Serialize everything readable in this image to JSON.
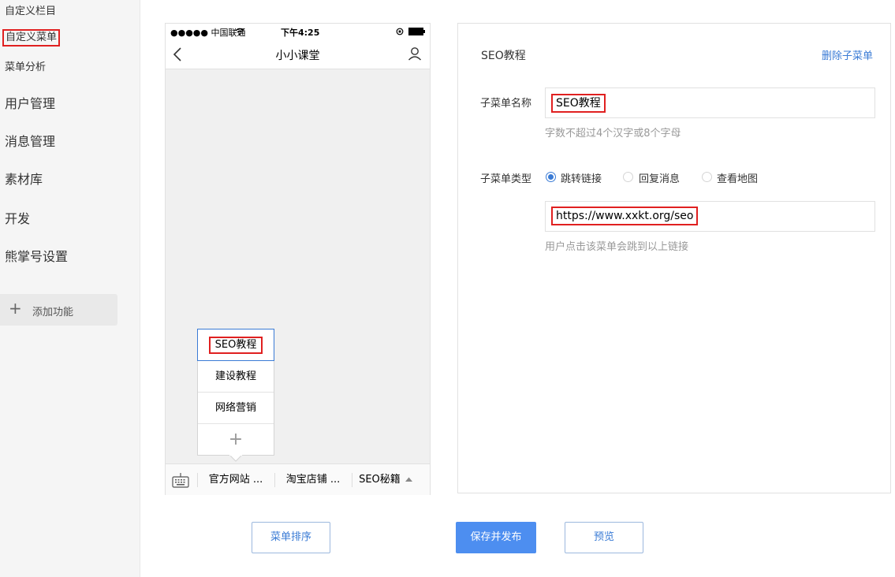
{
  "sidebar": {
    "sub_items": [
      "自定义栏目",
      "自定义菜单",
      "菜单分析"
    ],
    "main_items": [
      "用户管理",
      "消息管理",
      "素材库",
      "开发",
      "熊掌号设置"
    ],
    "add_function": "添加功能"
  },
  "phone": {
    "carrier": "●●●●● 中国联通",
    "time": "下午4:25",
    "title": "小小课堂",
    "menus": [
      "官方网站 ...",
      "淘宝店铺 ...",
      "SEO秘籍"
    ],
    "submenus": [
      "SEO教程",
      "建设教程",
      "网络营销"
    ],
    "add_symbol": "+"
  },
  "editor": {
    "title": "SEO教程",
    "delete_link": "删除子菜单",
    "name_label": "子菜单名称",
    "name_value": "SEO教程",
    "name_hint": "字数不超过4个汉字或8个字母",
    "type_label": "子菜单类型",
    "type_options": [
      "跳转链接",
      "回复消息",
      "查看地图"
    ],
    "url_value": "https://www.xxkt.org/seo",
    "url_hint": "用户点击该菜单会跳到以上链接"
  },
  "buttons": {
    "sort": "菜单排序",
    "publish": "保存并发布",
    "preview": "预览"
  },
  "colors": {
    "accent": "#4d8ef0",
    "highlight": "#e02020"
  }
}
